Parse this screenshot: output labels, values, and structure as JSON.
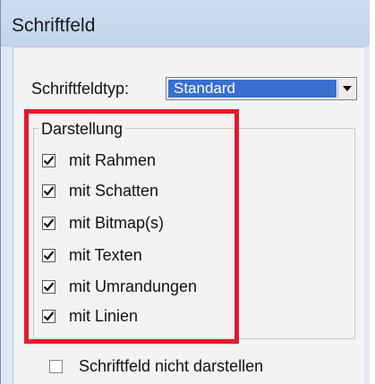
{
  "window": {
    "title": "Schriftfeld"
  },
  "type_field": {
    "label": "Schriftfeldtyp:",
    "value": "Standard",
    "arrow_icon": "chevron-down-icon"
  },
  "group": {
    "title": "Darstellung",
    "options": [
      {
        "label": "mit Rahmen",
        "checked": true
      },
      {
        "label": "mit Schatten",
        "checked": true
      },
      {
        "label": "mit Bitmap(s)",
        "checked": true
      },
      {
        "label": "mit Texten",
        "checked": true
      },
      {
        "label": "mit Umrandungen",
        "checked": true
      },
      {
        "label": "mit Linien",
        "checked": true
      }
    ]
  },
  "hide_option": {
    "label": "Schriftfeld nicht darstellen",
    "checked": false
  },
  "colors": {
    "selection": "#3a6fd0",
    "highlight_frame": "#e21b2a",
    "title_bar": "#c3d5ec"
  }
}
